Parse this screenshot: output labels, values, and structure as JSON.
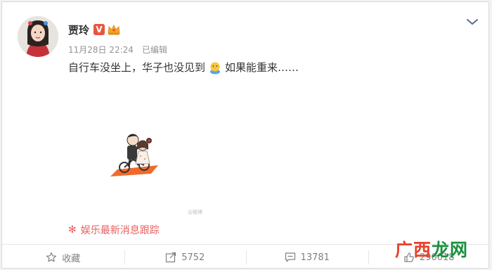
{
  "post": {
    "author": "贾玲",
    "verified_badge": "V",
    "timestamp": "11月28日 22:24",
    "edited_label": "已编辑",
    "text_before_emoji": "自行车没坐上，华子也没见到",
    "emoji_icon": "chick-emoji",
    "text_after_emoji": "如果能重来……",
    "image_watermark": "@微博",
    "topic_label": "娱乐最新消息跟踪"
  },
  "actions": {
    "favorite_label": "收藏",
    "repost_count": "5752",
    "comment_count": "13781",
    "like_count": "290018"
  },
  "watermark": {
    "text_red": "广西",
    "text_green": "龙网"
  },
  "colors": {
    "topic_red": "#e85f5f",
    "badge_red": "#e8563f",
    "scooter_orange": "#f06a2c"
  }
}
